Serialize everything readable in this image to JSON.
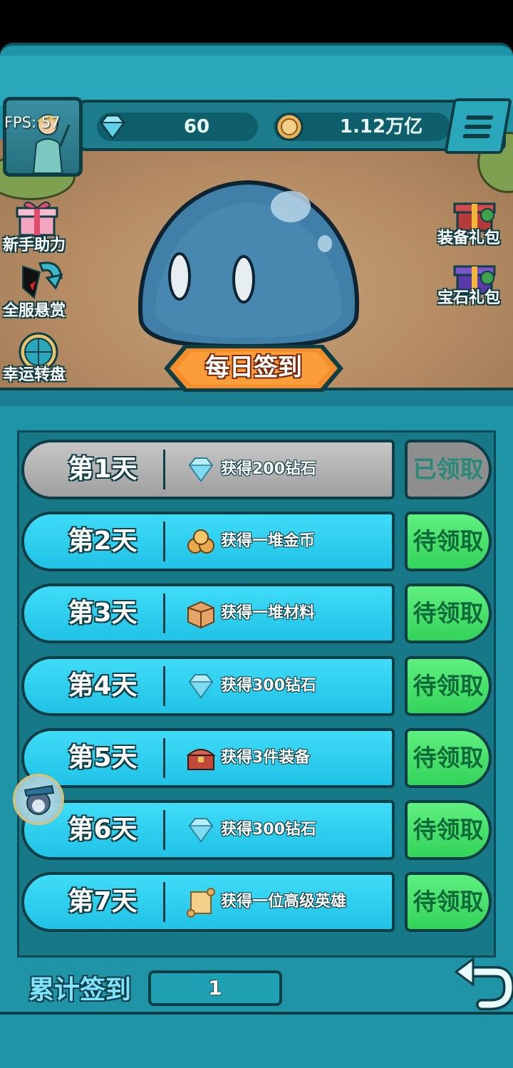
{
  "hud": {
    "fps_label": "FPS: 57",
    "gems": "60",
    "coins": "1.12万亿"
  },
  "side_left": [
    {
      "label": "新手助力",
      "icon": "gift-icon"
    },
    {
      "label": "全服悬赏",
      "icon": "bounty-icon"
    },
    {
      "label": "幸运转盘",
      "icon": "lucky-wheel-icon"
    }
  ],
  "side_right": [
    {
      "label": "装备礼包",
      "icon": "gift-box-icon"
    },
    {
      "label": "宝石礼包",
      "icon": "gift-box-icon"
    }
  ],
  "title": "每日签到",
  "rows": [
    {
      "day": "第1天",
      "reward": "获得200钻石",
      "icon": "diamond-icon",
      "status": "已领取",
      "claimed": true
    },
    {
      "day": "第2天",
      "reward": "获得一堆金币",
      "icon": "coins-icon",
      "status": "待领取",
      "claimed": false
    },
    {
      "day": "第3天",
      "reward": "获得一堆材料",
      "icon": "material-box-icon",
      "status": "待领取",
      "claimed": false
    },
    {
      "day": "第4天",
      "reward": "获得300钻石",
      "icon": "diamond-icon",
      "status": "待领取",
      "claimed": false
    },
    {
      "day": "第5天",
      "reward": "获得3件装备",
      "icon": "treasure-chest-icon",
      "status": "待领取",
      "claimed": false
    },
    {
      "day": "第6天",
      "reward": "获得300钻石",
      "icon": "diamond-icon",
      "status": "待领取",
      "claimed": false
    },
    {
      "day": "第7天",
      "reward": "获得一位高级英雄",
      "icon": "scroll-icon",
      "status": "待领取",
      "claimed": false
    }
  ],
  "footer": {
    "label": "累计签到",
    "value": "1"
  },
  "colors": {
    "panel": "#177888",
    "row_pending": "#29cbed",
    "row_claimed": "#b0b0b0",
    "button_pending": "#44e06a",
    "outline": "#0d3d45"
  }
}
